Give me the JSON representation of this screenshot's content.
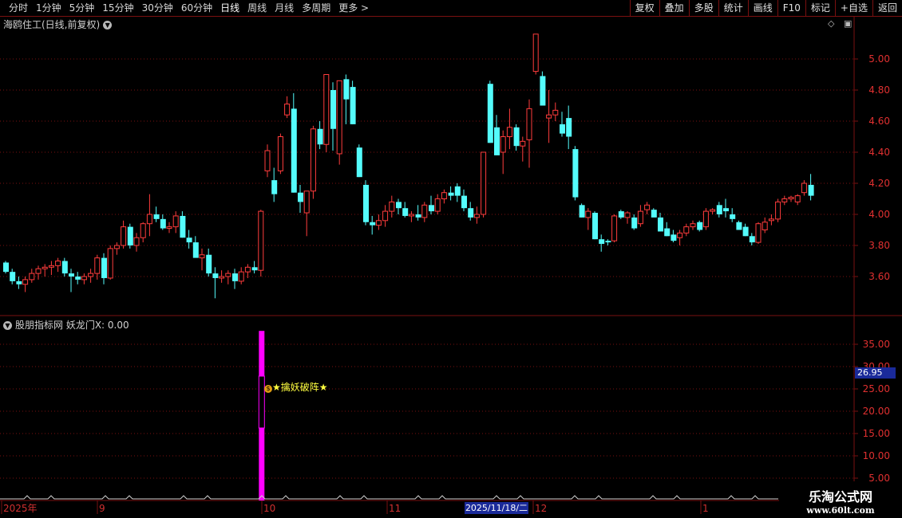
{
  "toolbar": {
    "periods": [
      "分时",
      "1分钟",
      "5分钟",
      "15分钟",
      "30分钟",
      "60分钟",
      "日线",
      "周线",
      "月线",
      "多周期",
      "更多 >"
    ],
    "active_period": "日线",
    "actions": [
      "复权",
      "叠加",
      "多股",
      "统计",
      "画线",
      "F10",
      "标记",
      "+自选",
      "返回"
    ]
  },
  "main": {
    "title": "海鸥住工(日线,前复权)"
  },
  "indicator": {
    "title": "股朋指标网 妖龙门X: 0.00",
    "signal": "★擒妖破阵★",
    "current_value": "26.95"
  },
  "colors": {
    "up": "#ff3c3c",
    "down": "#54fcfc",
    "bar": "#ff00ff",
    "grid": "#7a1010"
  },
  "chart_data": [
    {
      "type": "candlestick",
      "title": "海鸥住工(日线,前复权)",
      "y_ticks": [
        "5.00",
        "4.80",
        "4.60",
        "4.40",
        "4.20",
        "4.00",
        "3.80",
        "3.60"
      ],
      "ylim": [
        3.4,
        5.2
      ],
      "x_labels": [
        "2025年",
        "9",
        "10",
        "11",
        "12",
        "1"
      ],
      "cursor_date": "2025/11/18/二",
      "ohlc": [
        [
          3.69,
          3.7,
          3.62,
          3.63
        ],
        [
          3.63,
          3.65,
          3.55,
          3.57
        ],
        [
          3.57,
          3.6,
          3.52,
          3.55
        ],
        [
          3.55,
          3.6,
          3.5,
          3.58
        ],
        [
          3.58,
          3.65,
          3.56,
          3.62
        ],
        [
          3.62,
          3.67,
          3.58,
          3.65
        ],
        [
          3.65,
          3.68,
          3.6,
          3.66
        ],
        [
          3.66,
          3.7,
          3.61,
          3.67
        ],
        [
          3.67,
          3.72,
          3.63,
          3.7
        ],
        [
          3.7,
          3.72,
          3.6,
          3.62
        ],
        [
          3.62,
          3.65,
          3.5,
          3.6
        ],
        [
          3.6,
          3.63,
          3.55,
          3.58
        ],
        [
          3.58,
          3.62,
          3.55,
          3.6
        ],
        [
          3.6,
          3.65,
          3.56,
          3.62
        ],
        [
          3.62,
          3.74,
          3.58,
          3.72
        ],
        [
          3.72,
          3.75,
          3.55,
          3.59
        ],
        [
          3.59,
          3.8,
          3.58,
          3.78
        ],
        [
          3.78,
          3.82,
          3.74,
          3.8
        ],
        [
          3.8,
          3.96,
          3.78,
          3.92
        ],
        [
          3.92,
          3.94,
          3.78,
          3.8
        ],
        [
          3.8,
          3.88,
          3.76,
          3.85
        ],
        [
          3.85,
          3.95,
          3.82,
          3.94
        ],
        [
          3.94,
          4.13,
          3.86,
          4.0
        ],
        [
          4.0,
          4.05,
          3.95,
          3.97
        ],
        [
          3.97,
          4.0,
          3.9,
          3.91
        ],
        [
          3.91,
          3.95,
          3.88,
          3.92
        ],
        [
          3.92,
          4.02,
          3.88,
          3.99
        ],
        [
          3.99,
          4.02,
          3.85,
          3.85
        ],
        [
          3.85,
          3.9,
          3.78,
          3.82
        ],
        [
          3.82,
          3.86,
          3.74,
          3.72
        ],
        [
          3.72,
          3.78,
          3.64,
          3.74
        ],
        [
          3.74,
          3.78,
          3.6,
          3.62
        ],
        [
          3.62,
          3.66,
          3.46,
          3.59
        ],
        [
          3.59,
          3.64,
          3.56,
          3.6
        ],
        [
          3.6,
          3.64,
          3.55,
          3.62
        ],
        [
          3.62,
          3.65,
          3.52,
          3.57
        ],
        [
          3.57,
          3.66,
          3.55,
          3.63
        ],
        [
          3.63,
          3.68,
          3.59,
          3.66
        ],
        [
          3.66,
          3.7,
          3.62,
          3.64
        ],
        [
          3.64,
          4.03,
          3.6,
          4.02
        ],
        [
          4.28,
          4.45,
          4.24,
          4.41
        ],
        [
          4.22,
          4.3,
          4.08,
          4.13
        ],
        [
          4.28,
          4.52,
          4.26,
          4.5
        ],
        [
          4.64,
          4.76,
          4.62,
          4.71
        ],
        [
          4.68,
          4.78,
          4.14,
          4.14
        ],
        [
          4.14,
          4.19,
          4.01,
          4.08
        ],
        [
          4.01,
          4.15,
          3.86,
          4.15
        ],
        [
          4.15,
          4.57,
          4.1,
          4.55
        ],
        [
          4.55,
          4.6,
          4.42,
          4.45
        ],
        [
          4.45,
          4.9,
          4.4,
          4.9
        ],
        [
          4.8,
          4.85,
          4.41,
          4.55
        ],
        [
          4.39,
          4.86,
          4.32,
          4.86
        ],
        [
          4.87,
          4.9,
          4.58,
          4.74
        ],
        [
          4.82,
          4.86,
          4.58,
          4.58
        ],
        [
          4.43,
          4.45,
          4.24,
          4.24
        ],
        [
          4.19,
          4.22,
          3.93,
          3.95
        ],
        [
          3.95,
          3.99,
          3.87,
          3.93
        ],
        [
          3.93,
          4.0,
          3.9,
          3.96
        ],
        [
          3.96,
          4.06,
          3.92,
          4.02
        ],
        [
          4.02,
          4.12,
          3.98,
          4.08
        ],
        [
          4.08,
          4.1,
          4.0,
          4.04
        ],
        [
          4.04,
          4.08,
          3.98,
          3.99
        ],
        [
          3.99,
          4.02,
          3.95,
          4.0
        ],
        [
          4.0,
          4.06,
          3.96,
          3.98
        ],
        [
          3.98,
          4.08,
          3.95,
          4.06
        ],
        [
          4.06,
          4.12,
          4.0,
          4.02
        ],
        [
          4.02,
          4.13,
          4.0,
          4.1
        ],
        [
          4.1,
          4.16,
          4.07,
          4.14
        ],
        [
          4.14,
          4.18,
          4.09,
          4.12
        ],
        [
          4.18,
          4.2,
          4.08,
          4.12
        ],
        [
          4.12,
          4.16,
          4.02,
          4.04
        ],
        [
          4.04,
          4.08,
          3.96,
          3.98
        ],
        [
          3.98,
          4.05,
          3.94,
          4.0
        ],
        [
          4.0,
          4.4,
          3.98,
          4.4
        ],
        [
          4.84,
          4.86,
          4.46,
          4.46
        ],
        [
          4.56,
          4.64,
          4.4,
          4.38
        ],
        [
          4.4,
          4.54,
          4.26,
          4.5
        ],
        [
          4.5,
          4.68,
          4.42,
          4.56
        ],
        [
          4.56,
          4.58,
          4.41,
          4.44
        ],
        [
          4.44,
          4.5,
          4.34,
          4.47
        ],
        [
          4.48,
          4.74,
          4.3,
          4.68
        ],
        [
          4.92,
          5.16,
          4.9,
          5.16
        ],
        [
          4.89,
          4.92,
          4.7,
          4.7
        ],
        [
          4.62,
          4.8,
          4.46,
          4.64
        ],
        [
          4.64,
          4.72,
          4.6,
          4.67
        ],
        [
          4.58,
          4.66,
          4.5,
          4.52
        ],
        [
          4.62,
          4.7,
          4.42,
          4.5
        ],
        [
          4.42,
          4.44,
          4.09,
          4.11
        ],
        [
          4.06,
          4.07,
          3.98,
          3.98
        ],
        [
          3.98,
          4.04,
          3.9,
          4.02
        ],
        [
          4.01,
          4.02,
          3.84,
          3.84
        ],
        [
          3.84,
          3.87,
          3.76,
          3.81
        ],
        [
          3.83,
          3.84,
          3.8,
          3.82
        ],
        [
          3.83,
          4.0,
          3.82,
          3.99
        ],
        [
          4.02,
          4.03,
          3.97,
          3.98
        ],
        [
          3.98,
          4.02,
          3.94,
          4.01
        ],
        [
          3.98,
          4.0,
          3.9,
          3.91
        ],
        [
          3.94,
          4.06,
          3.92,
          4.02
        ],
        [
          4.03,
          4.08,
          4.0,
          4.06
        ],
        [
          4.03,
          4.04,
          3.99,
          3.98
        ],
        [
          3.98,
          4.01,
          3.89,
          3.89
        ],
        [
          3.91,
          3.95,
          3.86,
          3.86
        ],
        [
          3.87,
          3.9,
          3.82,
          3.83
        ],
        [
          3.85,
          3.9,
          3.8,
          3.88
        ],
        [
          3.88,
          3.94,
          3.86,
          3.92
        ],
        [
          3.92,
          3.96,
          3.9,
          3.94
        ],
        [
          3.95,
          3.96,
          3.89,
          3.9
        ],
        [
          3.92,
          4.04,
          3.9,
          4.02
        ],
        [
          4.02,
          4.04,
          4.0,
          4.03
        ],
        [
          4.06,
          4.08,
          3.98,
          4.0
        ],
        [
          4.04,
          4.1,
          3.98,
          4.02
        ],
        [
          4.0,
          4.04,
          3.95,
          3.97
        ],
        [
          3.95,
          3.96,
          3.9,
          3.9
        ],
        [
          3.92,
          3.94,
          3.86,
          3.86
        ],
        [
          3.86,
          3.88,
          3.8,
          3.82
        ],
        [
          3.82,
          3.95,
          3.81,
          3.94
        ],
        [
          3.9,
          3.98,
          3.88,
          3.95
        ],
        [
          3.96,
          4.0,
          3.93,
          3.97
        ],
        [
          3.97,
          4.1,
          3.95,
          4.08
        ],
        [
          4.08,
          4.12,
          4.06,
          4.1
        ],
        [
          4.1,
          4.12,
          4.08,
          4.11
        ],
        [
          4.08,
          4.13,
          4.06,
          4.12
        ],
        [
          4.14,
          4.22,
          4.12,
          4.2
        ],
        [
          4.19,
          4.26,
          4.09,
          4.12
        ]
      ]
    },
    {
      "type": "bar",
      "title": "股朋指标网 妖龙门X: 0.00",
      "y_ticks": [
        "35.00",
        "30.00",
        "25.00",
        "20.00",
        "15.00",
        "10.00",
        "5.00"
      ],
      "ylim": [
        0,
        40
      ],
      "values_index": [
        39
      ],
      "values": [
        38
      ],
      "annotation": "★擒妖破阵★"
    }
  ]
}
